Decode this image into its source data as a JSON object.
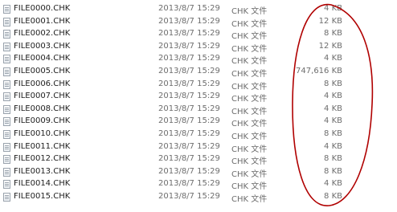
{
  "files": [
    {
      "name": "FILE0000.CHK",
      "date": "2013/8/7 15:29",
      "type": "CHK 文件",
      "size": "4 KB"
    },
    {
      "name": "FILE0001.CHK",
      "date": "2013/8/7 15:29",
      "type": "CHK 文件",
      "size": "12 KB"
    },
    {
      "name": "FILE0002.CHK",
      "date": "2013/8/7 15:29",
      "type": "CHK 文件",
      "size": "8 KB"
    },
    {
      "name": "FILE0003.CHK",
      "date": "2013/8/7 15:29",
      "type": "CHK 文件",
      "size": "12 KB"
    },
    {
      "name": "FILE0004.CHK",
      "date": "2013/8/7 15:29",
      "type": "CHK 文件",
      "size": "4 KB"
    },
    {
      "name": "FILE0005.CHK",
      "date": "2013/8/7 15:29",
      "type": "CHK 文件",
      "size": "747,616 KB"
    },
    {
      "name": "FILE0006.CHK",
      "date": "2013/8/7 15:29",
      "type": "CHK 文件",
      "size": "8 KB"
    },
    {
      "name": "FILE0007.CHK",
      "date": "2013/8/7 15:29",
      "type": "CHK 文件",
      "size": "4 KB"
    },
    {
      "name": "FILE0008.CHK",
      "date": "2013/8/7 15:29",
      "type": "CHK 文件",
      "size": "4 KB"
    },
    {
      "name": "FILE0009.CHK",
      "date": "2013/8/7 15:29",
      "type": "CHK 文件",
      "size": "4 KB"
    },
    {
      "name": "FILE0010.CHK",
      "date": "2013/8/7 15:29",
      "type": "CHK 文件",
      "size": "8 KB"
    },
    {
      "name": "FILE0011.CHK",
      "date": "2013/8/7 15:29",
      "type": "CHK 文件",
      "size": "4 KB"
    },
    {
      "name": "FILE0012.CHK",
      "date": "2013/8/7 15:29",
      "type": "CHK 文件",
      "size": "8 KB"
    },
    {
      "name": "FILE0013.CHK",
      "date": "2013/8/7 15:29",
      "type": "CHK 文件",
      "size": "8 KB"
    },
    {
      "name": "FILE0014.CHK",
      "date": "2013/8/7 15:29",
      "type": "CHK 文件",
      "size": "4 KB"
    },
    {
      "name": "FILE0015.CHK",
      "date": "2013/8/7 15:29",
      "type": "CHK 文件",
      "size": "8 KB"
    }
  ],
  "icons": {
    "file_icon": "chk-file-icon"
  },
  "colors": {
    "background": "#ffffff",
    "name_text": "#1e1e1e",
    "detail_text": "#6d6d6d",
    "annotation_ellipse": "#b00000"
  }
}
